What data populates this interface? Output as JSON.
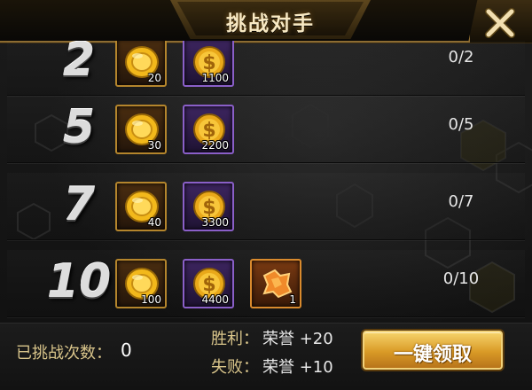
{
  "header": {
    "title": "挑战对手"
  },
  "icons": {
    "close": "close-x-icon",
    "gold": "gold-coin-icon",
    "money": "dollar-coin-icon",
    "fragment": "honor-fragment-icon"
  },
  "colors": {
    "accent_gold": "#d99a26",
    "frame_gold": "#b4852c",
    "frame_purple": "#8a5fc8",
    "frame_orange": "#d98a2d"
  },
  "rows": [
    {
      "rank": "2",
      "rewards": [
        {
          "icon": "gold-coin-icon",
          "qty": "20"
        },
        {
          "icon": "dollar-coin-icon",
          "qty": "1100"
        }
      ],
      "progress": "0/2"
    },
    {
      "rank": "5",
      "rewards": [
        {
          "icon": "gold-coin-icon",
          "qty": "30"
        },
        {
          "icon": "dollar-coin-icon",
          "qty": "2200"
        }
      ],
      "progress": "0/5"
    },
    {
      "rank": "7",
      "rewards": [
        {
          "icon": "gold-coin-icon",
          "qty": "40"
        },
        {
          "icon": "dollar-coin-icon",
          "qty": "3300"
        }
      ],
      "progress": "0/7"
    },
    {
      "rank": "10",
      "rewards": [
        {
          "icon": "gold-coin-icon",
          "qty": "100"
        },
        {
          "icon": "dollar-coin-icon",
          "qty": "4400"
        },
        {
          "icon": "honor-fragment-icon",
          "qty": "1"
        }
      ],
      "progress": "0/10"
    }
  ],
  "footer": {
    "challenge_label": "已挑战次数：",
    "challenge_count": "0",
    "win_label": "胜利：",
    "win_value": "荣誉 +20",
    "lose_label": "失败：",
    "lose_value": "荣誉 +10",
    "claim_button": "一键领取"
  }
}
